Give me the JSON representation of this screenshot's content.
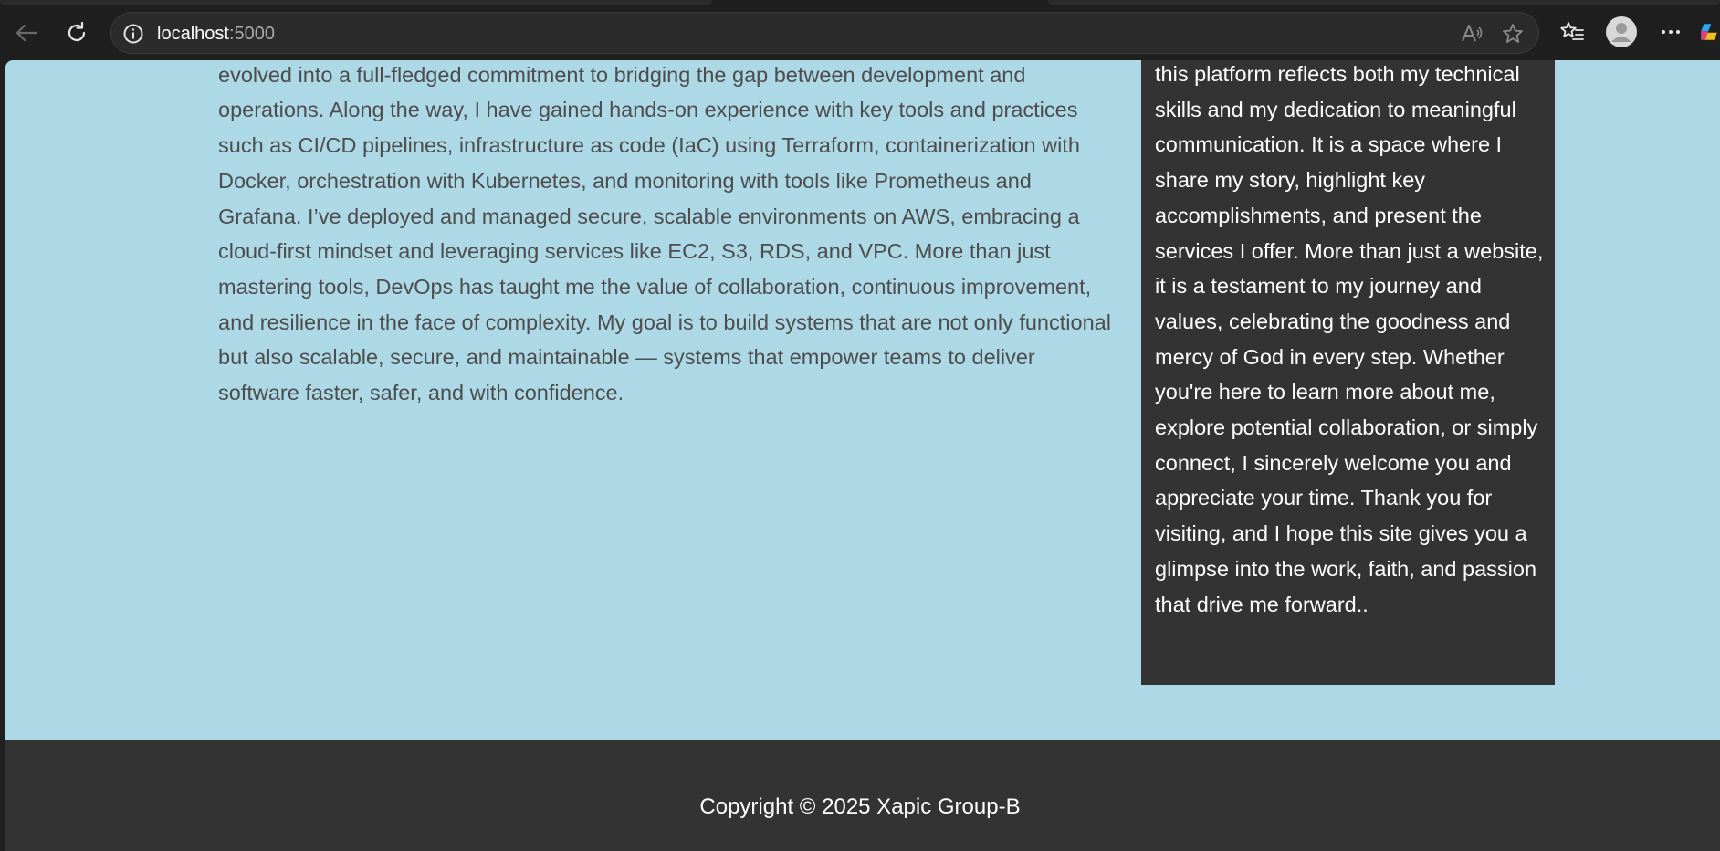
{
  "browser": {
    "url_host": "localhost",
    "url_port": ":5000",
    "icons": [
      "back-arrow-icon",
      "refresh-icon",
      "site-info-icon",
      "read-aloud-icon",
      "add-favorite-star-icon",
      "favorites-icon",
      "profile-avatar-icon",
      "more-menu-icon",
      "copilot-icon"
    ]
  },
  "main": {
    "paragraph": "operate seamlessly at scale. What started as an interest in automating routine tasks soon evolved into a full-fledged commitment to bridging the gap between development and operations. Along the way, I have gained hands-on experience with key tools and practices such as CI/CD pipelines, infrastructure as code (IaC) using Terraform, containerization with Docker, orchestration with Kubernetes, and monitoring with tools like Prometheus and Grafana. I’ve deployed and managed secure, scalable environments on AWS, embracing a cloud-first mindset and leveraging services like EC2, S3, RDS, and VPC. More than just mastering tools, DevOps has taught me the value of collaboration, continuous improvement, and resilience in the face of complexity. My goal is to build systems that are not only functional but also scalable, secure, and maintainable — systems that empower teams to deliver software faster, safer, and with confidence."
  },
  "aside": {
    "paragraph": "this platform reflects both my technical skills and my dedication to meaningful communication. It is a space where I share my story, highlight key accomplishments, and present the services I offer. More than just a website, it is a testament to my journey and values, celebrating the goodness and mercy of God in every step. Whether you're here to learn more about me, explore potential collaboration, or simply connect, I sincerely welcome you and appreciate your time. Thank you for visiting, and I hope this site gives you a glimpse into the work, faith, and passion that drive me forward.."
  },
  "footer": {
    "copyright": "Copyright © 2025 Xapic Group-B"
  },
  "colors": {
    "page_bg": "#add8e6",
    "panel_bg": "#333333",
    "body_text": "#4d4d4d"
  }
}
